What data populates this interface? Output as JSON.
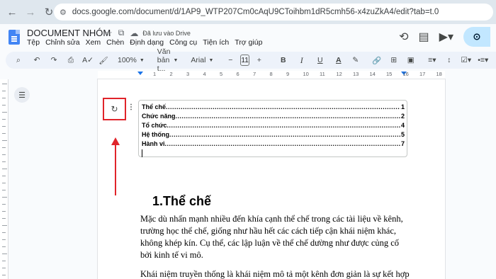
{
  "browser": {
    "url": "docs.google.com/document/d/1AP9_WTP207Cm0cAqU9CToihbm1dR5cmh56-x4zuZkA4/edit?tab=t.0"
  },
  "docs": {
    "title": "DOCUMENT NHÓM",
    "saved_status": "Đã lưu vào Drive",
    "menu": [
      "Tệp",
      "Chỉnh sửa",
      "Xem",
      "Chèn",
      "Định dạng",
      "Công cụ",
      "Tiện ích",
      "Trợ giúp"
    ]
  },
  "toolbar": {
    "zoom": "100%",
    "style": "Văn bản t...",
    "font": "Arial",
    "font_size": "11",
    "bold": "B",
    "italic": "I",
    "underline": "U",
    "text_color": "A"
  },
  "ruler": {
    "numbers": [
      "1",
      "2",
      "3",
      "4",
      "5",
      "6",
      "7",
      "8",
      "9",
      "10",
      "11",
      "12",
      "13",
      "14",
      "15",
      "16",
      "17",
      "18"
    ]
  },
  "toc": {
    "items": [
      {
        "label": "Thể chế",
        "page": "1"
      },
      {
        "label": "Chức năng",
        "page": "2"
      },
      {
        "label": "Tổ chức",
        "page": "4"
      },
      {
        "label": "Hệ thống",
        "page": "5"
      },
      {
        "label": "Hành vi",
        "page": "7"
      }
    ]
  },
  "content": {
    "heading": "1.Thể chế",
    "paragraph1": "Mặc dù nhấn mạnh nhiều đến khía cạnh thể chế trong các tài liệu về kênh, trường học thể chế, giống như hầu hết các cách tiếp cận khái niệm khác, không khép kín. Cụ thể, các lập luận về thể chế dường như được củng cố bởi kinh tế vi mô.",
    "paragraph2": "Khái niệm truyền thống là khái niệm mô tả một kênh đơn giản là sự kết hợp và"
  },
  "colors": {
    "highlight": "#e0242a",
    "docs_blue": "#4285f4"
  }
}
